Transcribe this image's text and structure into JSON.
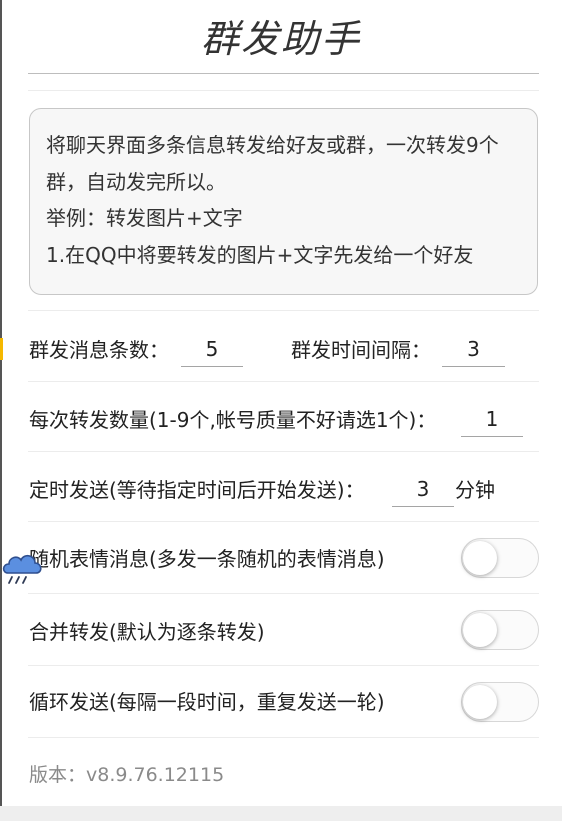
{
  "header": {
    "title": "群发助手"
  },
  "description": {
    "text": "将聊天界面多条信息转发给好友或群，一次转发9个群，自动发完所以。\n举例：转发图片+文字\n1.在QQ中将要转发的图片+文字先发给一个好友"
  },
  "settings": {
    "message_count": {
      "label": "群发消息条数：",
      "value": "5"
    },
    "interval": {
      "label": "群发时间间隔：",
      "value": "3"
    },
    "forward_count": {
      "label": "每次转发数量(1-9个,帐号质量不好请选1个)：",
      "value": "1"
    },
    "timer": {
      "label": "定时发送(等待指定时间后开始发送)：",
      "value": "3",
      "unit": "分钟"
    },
    "random_emoji": {
      "label": "随机表情消息(多发一条随机的表情消息)",
      "enabled": false
    },
    "merge_forward": {
      "label": "合并转发(默认为逐条转发)",
      "enabled": false
    },
    "loop_send": {
      "label": "循环发送(每隔一段时间，重复发送一轮)",
      "enabled": false
    }
  },
  "footer": {
    "version": "版本：v8.9.76.12115"
  },
  "icons": {
    "floating": "cloud-rain-icon"
  },
  "colors": {
    "toggle_off_track": "#fbfbfb",
    "divider": "#ececec",
    "version_text": "#8a8a8a"
  }
}
